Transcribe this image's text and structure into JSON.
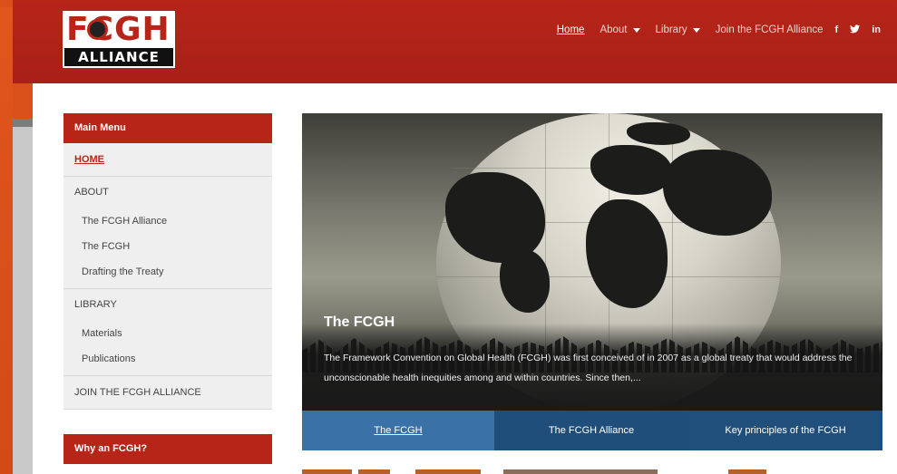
{
  "logo": {
    "top": "FCGH",
    "bottom": "ALLIANCE"
  },
  "nav": {
    "home": "Home",
    "about": "About",
    "library": "Library",
    "join": "Join the FCGH Alliance",
    "facebook": "f",
    "twitter": "t",
    "linkedin": "in"
  },
  "sidebar": {
    "title": "Main Menu",
    "home": "HOME",
    "about": "ABOUT",
    "about_items": [
      "The FCGH Alliance",
      "The FCGH",
      "Drafting the Treaty"
    ],
    "library": "LIBRARY",
    "library_items": [
      "Materials",
      "Publications"
    ],
    "join": "JOIN THE FCGH ALLIANCE",
    "why_title": "Why an FCGH?"
  },
  "hero": {
    "title": "The FCGH",
    "text": "The Framework Convention on Global Health (FCGH) was first conceived of in 2007 as a global treaty that would address the unconscionable health inequities among and within countries. Since then,..."
  },
  "tabs": [
    "The FCGH",
    "The FCGH Alliance",
    "Key principles of the FCGH"
  ],
  "colors": {
    "brand_red": "#b72519",
    "tab_blue": "#1f4e7a",
    "tab_active": "#3a72a8",
    "frame_orange": "#d9501a"
  }
}
